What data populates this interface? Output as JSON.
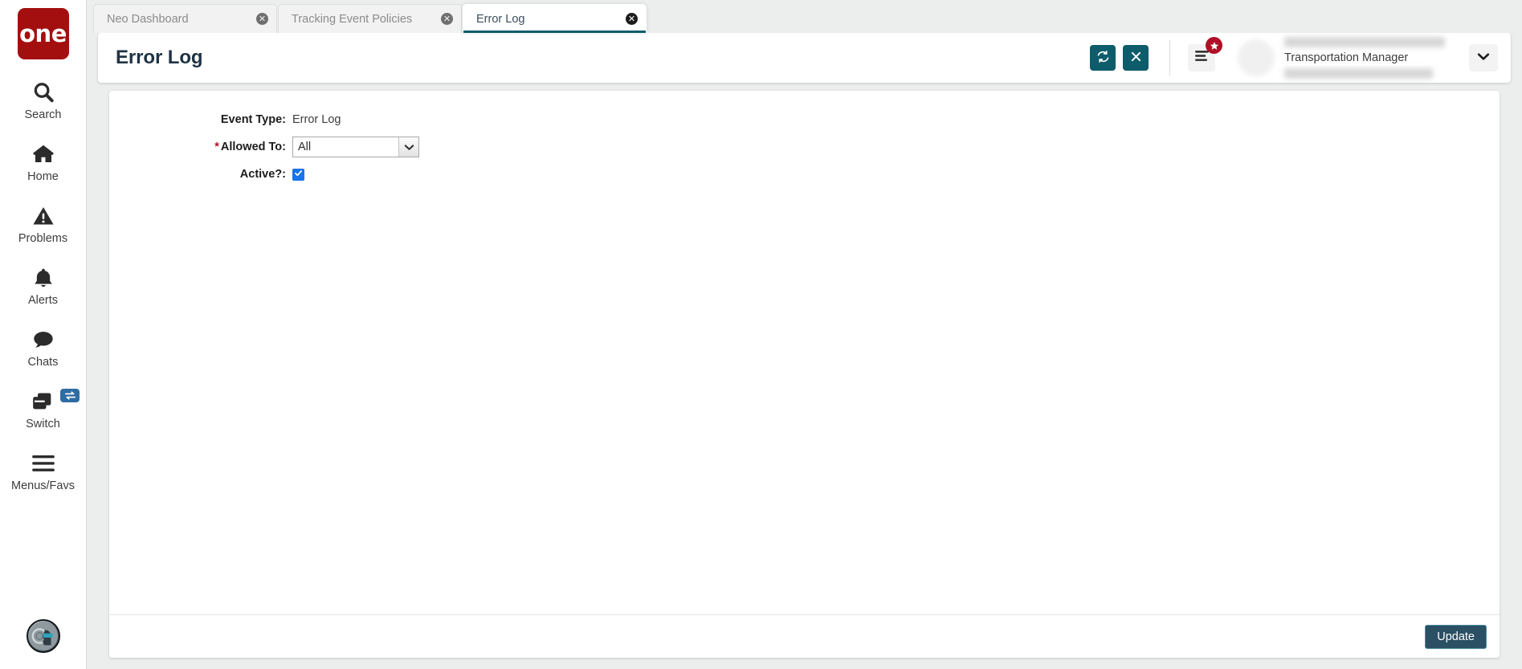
{
  "brand": {
    "logo_text": "one",
    "logo_color": "#a30f0f"
  },
  "sidebar": {
    "items": [
      {
        "label": "Search",
        "icon": "search-icon"
      },
      {
        "label": "Home",
        "icon": "home-icon"
      },
      {
        "label": "Problems",
        "icon": "warning-triangle-icon"
      },
      {
        "label": "Alerts",
        "icon": "bell-icon"
      },
      {
        "label": "Chats",
        "icon": "chat-bubble-icon"
      },
      {
        "label": "Switch",
        "icon": "windows-stack-icon",
        "badge_icon": "swap-arrows-icon"
      },
      {
        "label": "Menus/Favs",
        "icon": "hamburger-icon"
      }
    ],
    "assistant_avatar": "assistant-avatar-icon"
  },
  "tabs": [
    {
      "label": "Neo Dashboard",
      "active": false,
      "close_icon": "close-circle-icon"
    },
    {
      "label": "Tracking Event Policies",
      "active": false,
      "close_icon": "close-circle-icon"
    },
    {
      "label": "Error Log",
      "active": true,
      "close_icon": "close-circle-icon"
    }
  ],
  "header": {
    "title": "Error Log",
    "refresh_icon": "refresh-icon",
    "close_icon": "x-icon",
    "menu_icon": "list-menu-icon",
    "star_badge_icon": "star-icon",
    "chevron_icon": "chevron-down-icon",
    "accent_color": "#0d5c6b",
    "badge_color": "#b01027"
  },
  "user": {
    "role": "Transportation Manager"
  },
  "form": {
    "event_type_label": "Event Type:",
    "event_type_value": "Error Log",
    "allowed_to_label": "Allowed To:",
    "allowed_to_required": "*",
    "allowed_to_value": "All",
    "allowed_to_options": [
      "All"
    ],
    "active_label": "Active?:",
    "active_checked": true,
    "check_icon": "check-icon"
  },
  "footer": {
    "update_label": "Update"
  }
}
